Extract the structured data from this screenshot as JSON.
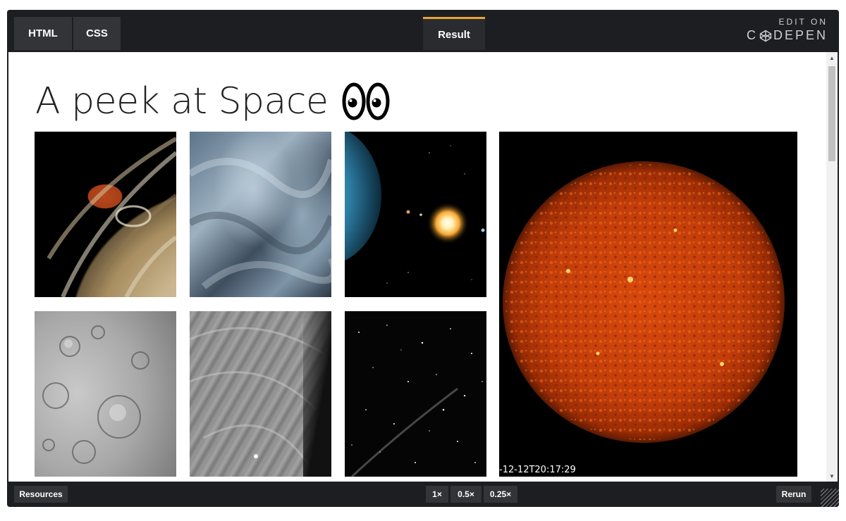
{
  "tabs": {
    "html": "HTML",
    "css": "CSS",
    "result": "Result"
  },
  "codepen": {
    "edit_on": "EDIT ON",
    "brand_left": "C",
    "brand_right": "DEPEN"
  },
  "result": {
    "title": "A peek at Space",
    "title_emoji": "eyes-icon",
    "sun_timestamp": "-12-12T20:17:29",
    "images": [
      {
        "name": "jupiter-image"
      },
      {
        "name": "dunes-image"
      },
      {
        "name": "exoplanet-system-image"
      },
      {
        "name": "sun-image"
      },
      {
        "name": "cratered-moon-image"
      },
      {
        "name": "surface-terrain-image"
      },
      {
        "name": "starfield-image"
      }
    ]
  },
  "footer": {
    "resources": "Resources",
    "zoom_1x": "1×",
    "zoom_05x": "0.5×",
    "zoom_025x": "0.25×",
    "rerun": "Rerun"
  },
  "colors": {
    "chrome_bg": "#1d1e22",
    "tab_bg": "#333438",
    "result_tab_accent": "#e8a436"
  }
}
